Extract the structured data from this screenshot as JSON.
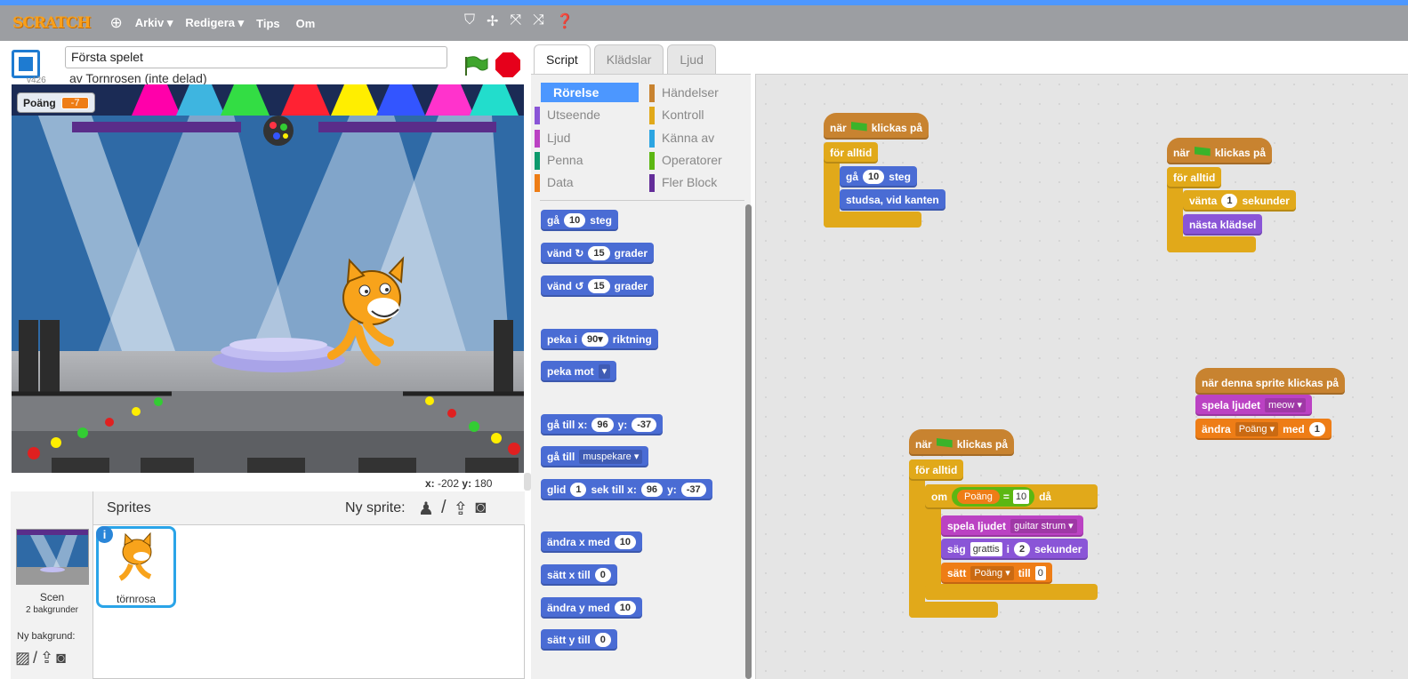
{
  "topbar": {
    "logo": "SCRATCH",
    "menus": [
      "Arkiv ▾",
      "Redigera ▾",
      "Tips",
      "Om"
    ],
    "tools": [
      "duplicate-tool",
      "cut-tool",
      "grow-tool",
      "shrink-tool",
      "help-tool"
    ]
  },
  "project": {
    "title": "Första spelet",
    "author": "av Tornrosen (inte delad)",
    "version": "v426"
  },
  "stage": {
    "monitor_label": "Poäng",
    "monitor_value": "-7",
    "coords_x_label": "x:",
    "coords_x": "-202",
    "coords_y_label": "y:",
    "coords_y": "180"
  },
  "sprites": {
    "header": "Sprites",
    "new_sprite": "Ny sprite:",
    "scene_label": "Scen",
    "scene_sub": "2 bakgrunder",
    "new_bg": "Ny bakgrund:",
    "sprite_name": "törnrosa"
  },
  "tabs": [
    "Script",
    "Klädslar",
    "Ljud"
  ],
  "categories": {
    "left": [
      "Rörelse",
      "Utseende",
      "Ljud",
      "Penna",
      "Data"
    ],
    "right": [
      "Händelser",
      "Kontroll",
      "Känna av",
      "Operatorer",
      "Fler Block"
    ],
    "colors_left": [
      "#4a6cd4",
      "#8a55d7",
      "#bb42c3",
      "#0e9a6c",
      "#ee7d16"
    ],
    "colors_right": [
      "#c88330",
      "#e1a91a",
      "#2ca5e2",
      "#5cb712",
      "#632d99"
    ]
  },
  "palette": {
    "b1": "gå",
    "b1n": "10",
    "b1s": "steg",
    "b2": "vänd ↻",
    "b2n": "15",
    "b2s": "grader",
    "b3": "vänd ↺",
    "b3n": "15",
    "b3s": "grader",
    "b4": "peka i",
    "b4n": "90▾",
    "b4s": "riktning",
    "b5": "peka mot",
    "b5d": "▾",
    "b6": "gå till x:",
    "b6n": "96",
    "b6y": "y:",
    "b6yn": "-37",
    "b7": "gå till",
    "b7d": "muspekare ▾",
    "b8": "glid",
    "b8n": "1",
    "b8s": "sek till x:",
    "b8x": "96",
    "b8y": "y:",
    "b8yn": "-37",
    "b9": "ändra x med",
    "b9n": "10",
    "b10": "sätt x till",
    "b10n": "0",
    "b11": "ändra y med",
    "b11n": "10",
    "b12": "sätt y till",
    "b12n": "0"
  },
  "scripts": {
    "when": "när",
    "clicked": "klickas på",
    "forever": "för alltid",
    "s1_move": "gå",
    "s1_move_n": "10",
    "s1_move_s": "steg",
    "s1_bounce": "studsa, vid kanten",
    "s2_wait": "vänta",
    "s2_wait_n": "1",
    "s2_wait_s": "sekunder",
    "s2_next": "nästa klädsel",
    "s3_hat": "när denna sprite klickas på",
    "s3_play": "spela ljudet",
    "s3_play_d": "meow ▾",
    "s3_change": "ändra",
    "s3_change_d": "Poäng ▾",
    "s3_change_s": "med",
    "s3_change_n": "1",
    "s4_if": "om",
    "s4_var": "Poäng",
    "s4_eq": "=",
    "s4_val": "10",
    "s4_then": "då",
    "s4_play": "spela ljudet",
    "s4_play_d": "guitar strum ▾",
    "s4_say": "säg",
    "s4_say_s": "grattis",
    "s4_say_i": "i",
    "s4_say_n": "2",
    "s4_say_sec": "sekunder",
    "s4_set": "sätt",
    "s4_set_d": "Poäng ▾",
    "s4_set_till": "till",
    "s4_set_n": "0"
  }
}
